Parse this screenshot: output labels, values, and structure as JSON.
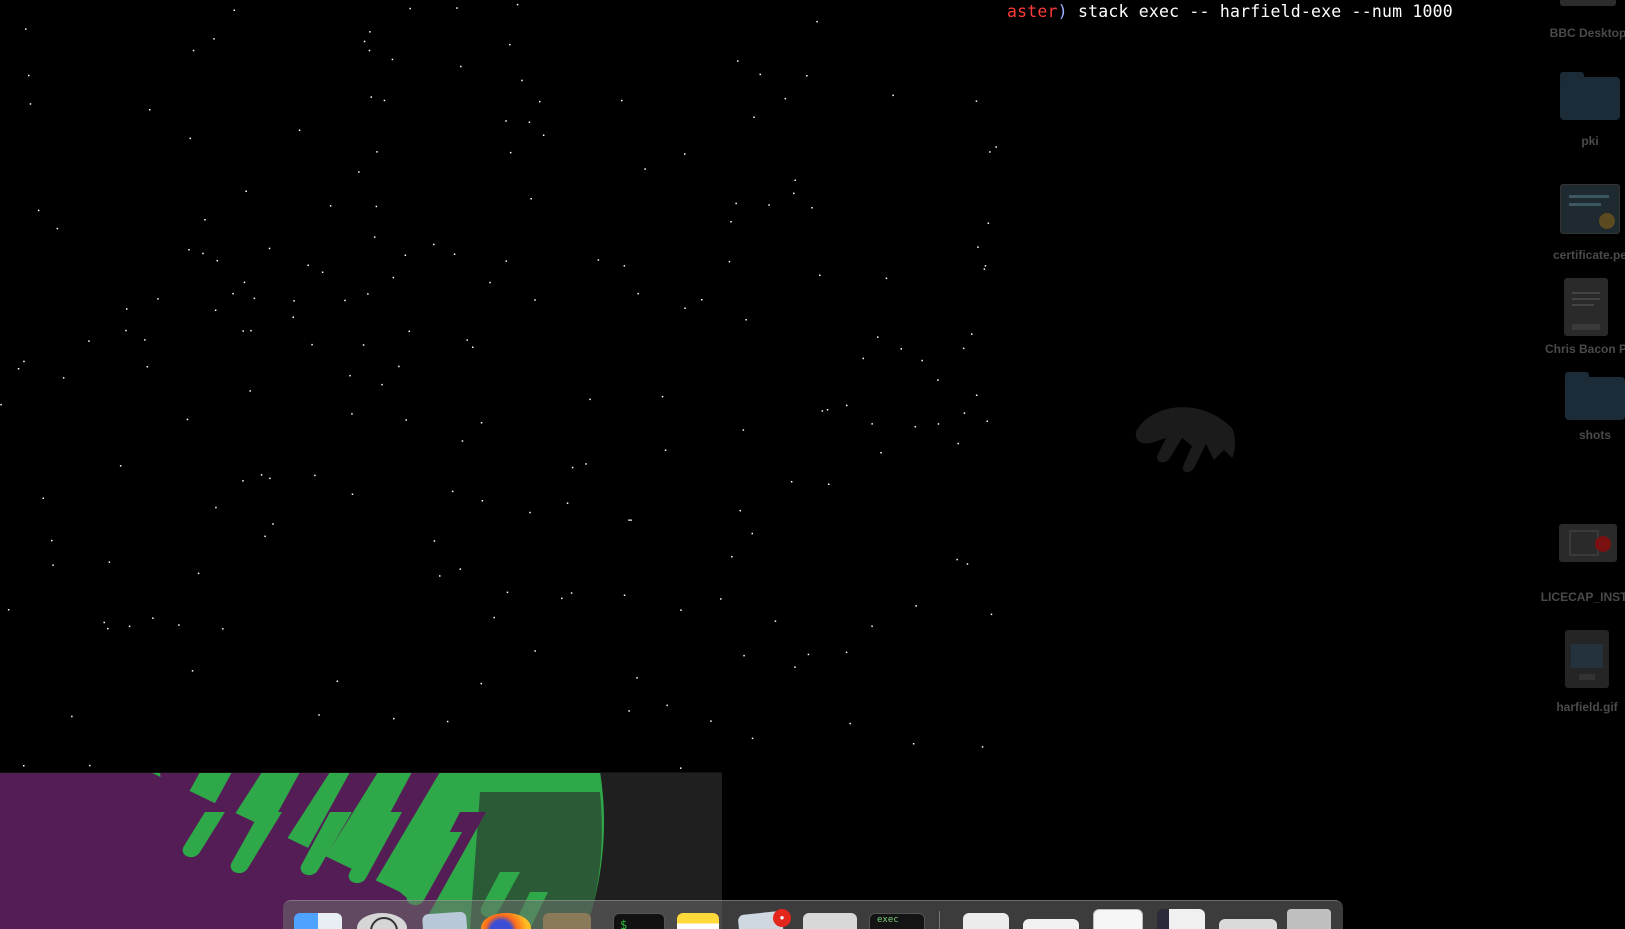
{
  "terminal": {
    "branch": "aster",
    "paren": ")",
    "command": " stack exec -- harfield-exe --num 1000"
  },
  "desktop_icons": [
    {
      "label": "BBC Desktop",
      "icon": "drive-icon"
    },
    {
      "label": "pki",
      "icon": "folder-icon"
    },
    {
      "label": "certificate.pe",
      "icon": "certificate-icon"
    },
    {
      "label": "Chris Bacon P",
      "icon": "docx-icon"
    },
    {
      "label": "shots",
      "icon": "folder-icon"
    },
    {
      "label": "LICECAP_INSTA",
      "icon": "installer-icon"
    },
    {
      "label": "harfield.gif",
      "icon": "gif-icon"
    }
  ],
  "dock": {
    "terminal_thumb_text": "exec",
    "notification_badge": "●",
    "items": [
      "finder-icon",
      "launchpad-icon",
      "preview-icon",
      "firefox-icon",
      "photos-icon",
      "terminal-icon",
      "notes-icon",
      "mail-icon",
      "window-thumbnail",
      "terminal-window-thumbnail",
      "document-thumbnail",
      "document-thumbnail",
      "document-thumbnail",
      "screenshot-thumbnail",
      "window-thumbnail",
      "trash-icon"
    ]
  },
  "colors": {
    "background": "#000000",
    "wallpaper_purple": "#541d55",
    "wallpaper_green": "#2fa84a",
    "branch_red": "#ff3b3b"
  }
}
